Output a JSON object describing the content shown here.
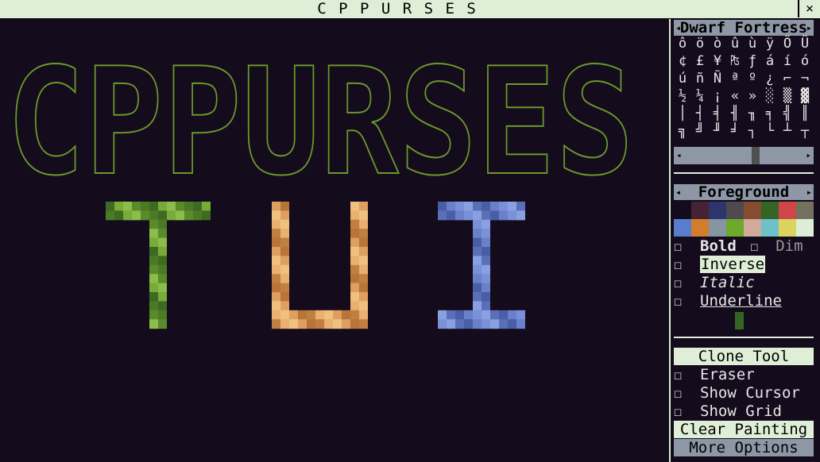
{
  "window": {
    "title": "C P P U R S E S",
    "close_icon": "×"
  },
  "canvas": {
    "banner_text": "CPPURSES",
    "banner_color": "#6a9a2a",
    "tui_letters": [
      {
        "glyph": "T",
        "palette": [
          "#3d6b22",
          "#5a8a2a",
          "#7aaa3a",
          "#4a7a26",
          "#8cbc4a"
        ]
      },
      {
        "glyph": "U",
        "palette": [
          "#c08040",
          "#dda060",
          "#e9b070",
          "#b8743a",
          "#f0c080"
        ]
      },
      {
        "glyph": "I",
        "palette": [
          "#5a6fb8",
          "#7a90d8",
          "#4a5ea8",
          "#8aa0e0",
          "#6a80c8"
        ]
      }
    ]
  },
  "sidebar": {
    "glyph_header": {
      "label": "Dwarf Fortress",
      "left_icon": "◂",
      "right_icon": "▸"
    },
    "glyph_rows": [
      [
        "ô",
        "ö",
        "ò",
        "û",
        "ù",
        "ÿ",
        "Ö",
        "Ü"
      ],
      [
        "¢",
        "£",
        "¥",
        "₧",
        "ƒ",
        "á",
        "í",
        "ó"
      ],
      [
        "ú",
        "ñ",
        "Ñ",
        "ª",
        "º",
        "¿",
        "⌐",
        "¬"
      ],
      [
        "½",
        "¼",
        "¡",
        "«",
        "»",
        "░",
        "▒",
        "▓"
      ],
      [
        "│",
        "┤",
        "╡",
        "╢",
        "╖",
        "╕",
        "╣",
        "║"
      ],
      [
        "╗",
        "╝",
        "╜",
        "╛",
        "┐",
        "└",
        "┴",
        "┬"
      ]
    ],
    "scroll": {
      "left_icon": "◂",
      "right_icon": "▸"
    },
    "color_header": {
      "label": "Foreground",
      "left_icon": "◂",
      "right_icon": "▸"
    },
    "palette_row1": [
      "#140c1c",
      "#442434",
      "#30346d",
      "#4e4a4e",
      "#854c30",
      "#346524",
      "#d04648",
      "#757161"
    ],
    "palette_row2": [
      "#597dce",
      "#d27d2c",
      "#8595a1",
      "#6daa2c",
      "#d2aa99",
      "#6dc2ca",
      "#dad45e",
      "#deeed6"
    ],
    "traits": {
      "checkbox_icon": "☐",
      "bold": "Bold",
      "dim": "Dim",
      "inverse": "Inverse",
      "italic": "Italic",
      "underline": "Underline"
    },
    "selected_color": "#346524",
    "tools": {
      "clone_tool": "Clone Tool",
      "eraser": "Eraser",
      "show_cursor": "Show Cursor",
      "show_grid": "Show Grid",
      "clear_painting": "Clear Painting",
      "more_options": "More Options"
    }
  }
}
